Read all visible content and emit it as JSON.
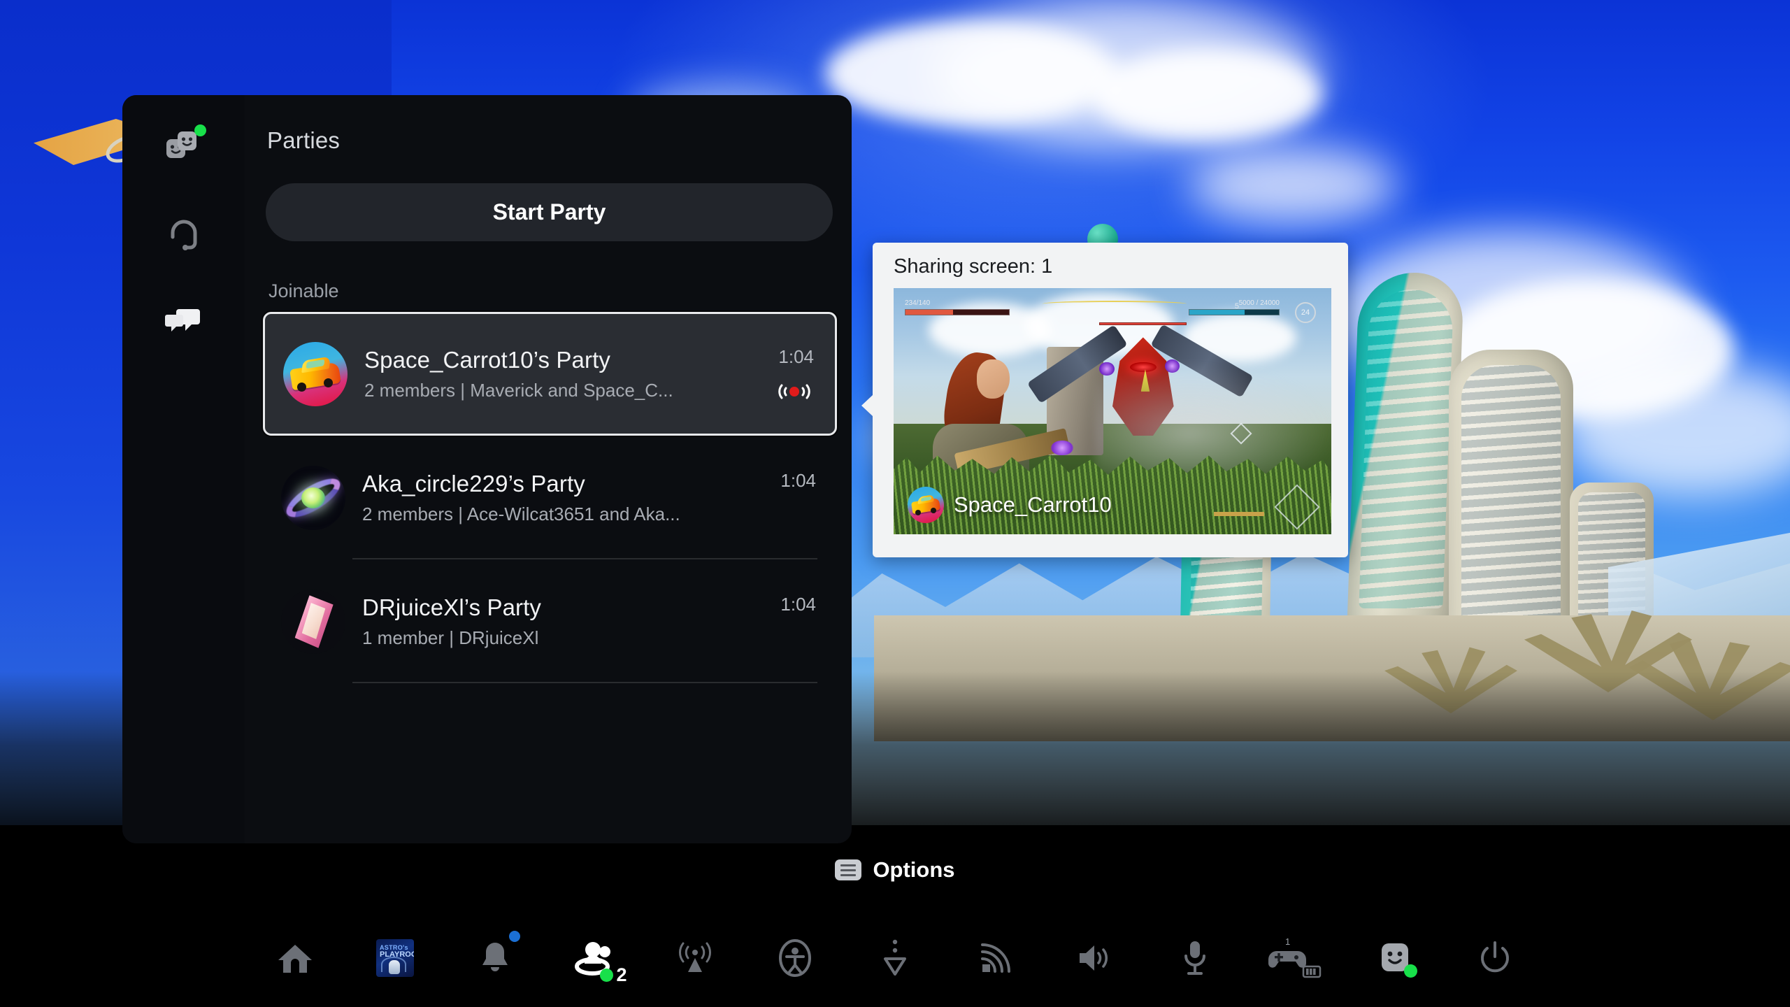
{
  "app": {
    "platform": "PlayStation 5 Control Center",
    "panel_title": "Parties"
  },
  "sidebar": {
    "items": [
      {
        "name": "game-base-icon",
        "label": "Game Base",
        "badge_color": "#18e04a",
        "has_badge": true
      },
      {
        "name": "voice-chat-icon",
        "label": "Voice Chat",
        "has_badge": false
      },
      {
        "name": "messages-icon",
        "label": "Messages",
        "has_badge": false,
        "active": true
      }
    ]
  },
  "main": {
    "title": "Parties",
    "start_party_label": "Start Party",
    "section_label": "Joinable",
    "parties": [
      {
        "title": "Space_Carrot10’s Party",
        "subtitle": "2 members | Maverick and Space_C...",
        "time": "1:04",
        "selected": true,
        "live": true,
        "avatar": "car-avatar"
      },
      {
        "title": "Aka_circle229’s Party",
        "subtitle": "2 members | Ace-Wilcat3651 and Aka...",
        "time": "1:04",
        "selected": false,
        "live": false,
        "avatar": "galaxy-avatar"
      },
      {
        "title": "DRjuiceXl’s Party",
        "subtitle": "1 member | DRjuiceXl",
        "time": "1:04",
        "selected": false,
        "live": false,
        "avatar": "prism-avatar"
      }
    ]
  },
  "share_card": {
    "title": "Sharing screen: 1",
    "user_name": "Space_Carrot10",
    "game_hud": {
      "health": "234/140",
      "xp": "5000 / 24000",
      "level": "24",
      "ammo_count": "5"
    }
  },
  "options": {
    "label": "Options",
    "icon": "hamburger-menu-icon"
  },
  "taskbar": {
    "items": [
      {
        "name": "home-icon",
        "label": "Home",
        "badge": null,
        "count": null
      },
      {
        "name": "game-tile-icon",
        "label": "ASTRO's PLAYROOM",
        "tile_top": "ASTRO's",
        "tile_main": "PLAYROOM",
        "badge": null,
        "count": null
      },
      {
        "name": "notifications-bell-icon",
        "label": "Notifications",
        "badge": "#1b6fd4",
        "count": null
      },
      {
        "name": "game-base-party-icon",
        "label": "Game Base",
        "badge": "#18e04a",
        "count": "2",
        "active": true
      },
      {
        "name": "broadcast-icon",
        "label": "Broadcast",
        "badge": null,
        "count": null
      },
      {
        "name": "accessibility-icon",
        "label": "Accessibility",
        "badge": null,
        "count": null
      },
      {
        "name": "downloads-icon",
        "label": "Downloads / Uploads",
        "badge": null,
        "count": null
      },
      {
        "name": "network-icon",
        "label": "Network",
        "badge": null,
        "count": null
      },
      {
        "name": "volume-icon",
        "label": "Sound",
        "badge": null,
        "count": null
      },
      {
        "name": "microphone-icon",
        "label": "Microphone",
        "badge": null,
        "count": null
      },
      {
        "name": "controller-icon",
        "label": "Controller",
        "badge": null,
        "count": "1"
      },
      {
        "name": "profile-avatar-icon",
        "label": "Profile",
        "badge": "#18e04a",
        "count": null
      },
      {
        "name": "power-icon",
        "label": "Power",
        "badge": null,
        "count": null
      }
    ]
  },
  "colors": {
    "accent_green": "#18e04a",
    "accent_blue": "#1b6fd4",
    "live_red": "#e11b1b",
    "panel_bg": "#0b0d11",
    "card_bg": "#f2f3f4"
  }
}
